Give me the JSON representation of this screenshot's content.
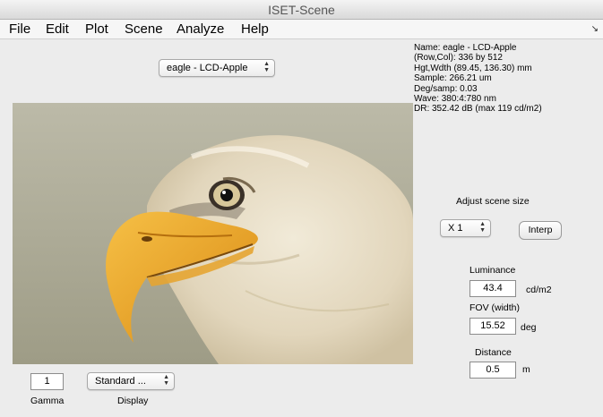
{
  "window": {
    "title": "ISET-Scene"
  },
  "menu": {
    "items": [
      "File",
      "Edit",
      "Plot",
      "Scene",
      "Analyze",
      "Help"
    ]
  },
  "scene_select": {
    "value": "eagle - LCD-Apple"
  },
  "info": {
    "lines": [
      "Name: eagle - LCD-Apple",
      "(Row,Col): 336 by 512",
      "Hgt,Wdth (89.45, 136.30) mm",
      "Sample: 266.21 um",
      "Deg/samp: 0.03",
      "Wave: 380:4:780 nm",
      "DR: 352.42 dB (max 119 cd/m2)"
    ]
  },
  "adjust": {
    "label": "Adjust scene size",
    "scale_value": "X 1",
    "interp_label": "Interp"
  },
  "luminance": {
    "label": "Luminance",
    "value": "43.4",
    "unit": "cd/m2"
  },
  "fov": {
    "label": "FOV (width)",
    "value": "15.52",
    "unit": "deg"
  },
  "distance": {
    "label": "Distance",
    "value": "0.5",
    "unit": "m"
  },
  "gamma": {
    "label": "Gamma",
    "value": "1"
  },
  "display": {
    "label": "Display",
    "value": "Standard ..."
  },
  "colors": {
    "eagle_beak": "#f2a926",
    "background": "#a8a690",
    "feathers": "#e6dcc8"
  }
}
